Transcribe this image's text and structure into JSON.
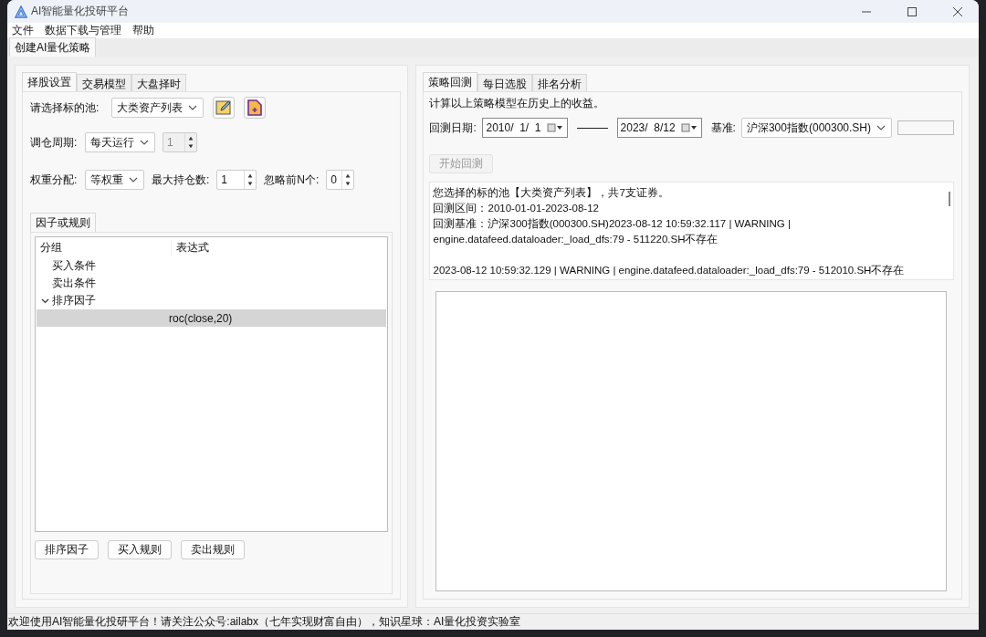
{
  "window": {
    "title": "AI智能量化投研平台"
  },
  "menu": [
    "文件",
    "数据下载与管理",
    "帮助"
  ],
  "main_tabs": [
    {
      "label": "创建AI量化策略",
      "selected": true
    }
  ],
  "left": {
    "tabs": [
      {
        "label": "择股设置",
        "selected": true
      },
      {
        "label": "交易模型",
        "selected": false
      },
      {
        "label": "大盘择时",
        "selected": false
      }
    ],
    "pool": {
      "label": "请选择标的池:",
      "value": "大类资产列表"
    },
    "period": {
      "label": "调仓周期:",
      "value": "每天运行",
      "spin": "1",
      "spin_disabled": true
    },
    "weight": {
      "label": "权重分配:",
      "value": "等权重",
      "max_label": "最大持仓数:",
      "max_value": "1",
      "skip_label": "忽略前N个:",
      "skip_value": "0"
    },
    "group_tab": "因子或规则",
    "tree": {
      "columns": [
        "分组",
        "表达式"
      ],
      "items": [
        {
          "group": "买入条件",
          "selected": false
        },
        {
          "group": "卖出条件",
          "selected": false
        },
        {
          "group": "排序因子",
          "selected": false,
          "expanded": true,
          "children": [
            {
              "expression": "roc(close,20)",
              "selected": true
            }
          ]
        }
      ]
    },
    "buttons": [
      "排序因子",
      "买入规则",
      "卖出规则"
    ]
  },
  "right": {
    "tabs": [
      {
        "label": "策略回测",
        "selected": true
      },
      {
        "label": "每日选股",
        "selected": false
      },
      {
        "label": "排名分析",
        "selected": false
      }
    ],
    "description": "计算以上策略模型在历史上的收益。",
    "date_label": "回测日期:",
    "start_date": "2010/  1/  1",
    "end_date": "2023/  8/12",
    "benchmark_label": "基准:",
    "benchmark": "沪深300指数(000300.SH)",
    "progress": {
      "level": 0
    },
    "start_button": {
      "label": "开始回测",
      "disabled": true
    },
    "log": [
      {
        "lines": [
          "您选择的标的池【大类资产列表】，共7支证券。",
          "回测区间：2010-01-01-2023-08-12",
          "回测基准：沪深300指数(000300.SH)2023-08-12 10:59:32.117 | WARNING  |",
          "engine.datafeed.dataloader:_load_dfs:79 - 511220.SH不存在"
        ]
      },
      {
        "lines": [
          "2023-08-12 10:59:32.129 | WARNING  | engine.datafeed.dataloader:_load_dfs:79 - 512010.SH不存在"
        ]
      }
    ]
  },
  "status_bar": "欢迎使用AI智能量化投研平台！请关注公众号:ailabx（七年实现财富自由），知识星球：AI量化投资实验室"
}
